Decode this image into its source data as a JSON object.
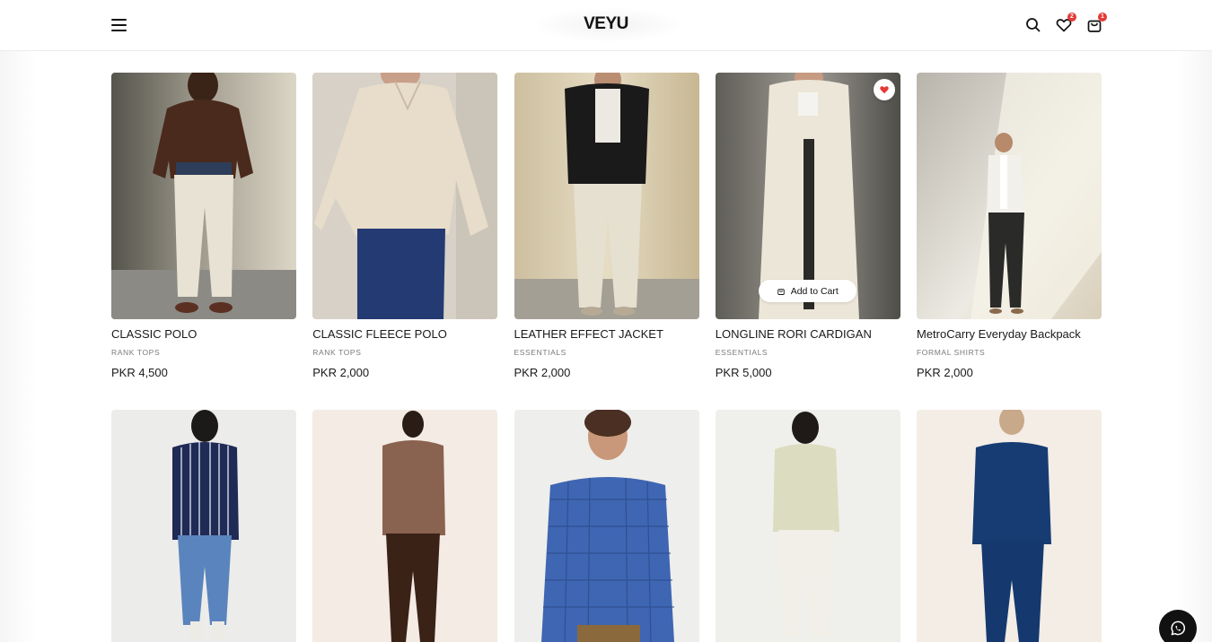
{
  "header": {
    "logo": "VEYU",
    "wishlist_count": "2",
    "cart_count": "1"
  },
  "products": [
    {
      "name": "CLASSIC POLO",
      "category": "RANK TOPS",
      "price": "PKR 4,500"
    },
    {
      "name": "CLASSIC FLEECE POLO",
      "category": "RANK TOPS",
      "price": "PKR 2,000"
    },
    {
      "name": "LEATHER EFFECT JACKET",
      "category": "ESSENTIALS",
      "price": "PKR 2,000"
    },
    {
      "name": "LONGLINE RORI CARDIGAN",
      "category": "ESSENTIALS",
      "price": "PKR 5,000",
      "add_to_cart": "Add to Cart",
      "wishlisted": true
    },
    {
      "name": "MetroCarry Everyday Backpack",
      "category": "FORMAL SHIRTS",
      "price": "PKR 2,000"
    }
  ],
  "products_row2_images": [
    {
      "depicts": "striped-shirt-model"
    },
    {
      "depicts": "brown-shirt-model"
    },
    {
      "depicts": "blue-check-shirt-model"
    },
    {
      "depicts": "linen-shirt-model"
    },
    {
      "depicts": "navy-shirt-model"
    }
  ],
  "colors": {
    "accent_badge": "#e53935",
    "heart": "#e53935",
    "whatsapp_bg": "#111111"
  },
  "icons": {
    "menu": "hamburger-icon",
    "search": "search-icon",
    "wishlist": "heart-icon",
    "cart": "shopping-bag-icon",
    "whatsapp": "whatsapp-icon"
  }
}
